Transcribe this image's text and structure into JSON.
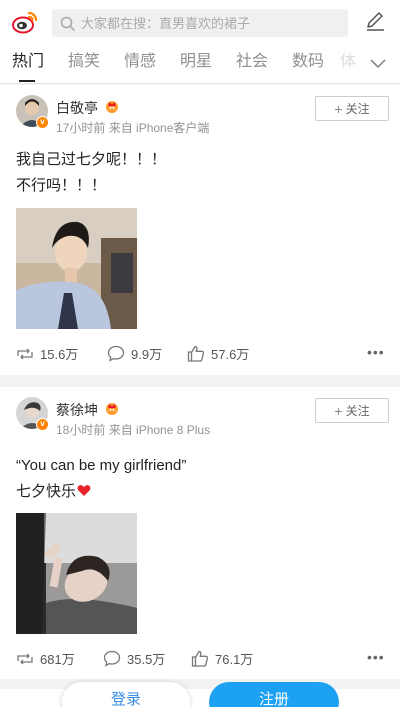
{
  "search": {
    "placeholder": "大家都在搜：直男喜欢的裙子"
  },
  "tabs": [
    "热门",
    "搞笑",
    "情感",
    "明星",
    "社会",
    "数码",
    "体"
  ],
  "colors": {
    "accent": "#ff8200",
    "brand": "#e6162d",
    "register": "#1da1f2",
    "login_text": "#3a8ee6"
  },
  "posts": [
    {
      "name": "白敬亭",
      "time": "17小时前",
      "source": "来自 iPhone客户端",
      "follow_label": "关注",
      "text_lines": [
        "我自己过七夕呢！！！",
        "不行吗！！！"
      ],
      "repost": "15.6万",
      "comment": "9.9万",
      "like": "57.6万"
    },
    {
      "name": "蔡徐坤",
      "time": "18小时前",
      "source": "来自 iPhone 8 Plus",
      "follow_label": "关注",
      "text_lines": [
        "“You can be my girlfriend”",
        "七夕快乐"
      ],
      "repost": "681万",
      "comment": "35.5万",
      "like": "76.1万"
    }
  ],
  "bottom": {
    "login": "登录",
    "register": "注册"
  },
  "icons": {
    "logo": "weibo-logo-icon",
    "search": "search-icon",
    "compose": "compose-icon",
    "more_tabs": "chevron-down-icon",
    "repost": "repost-icon",
    "comment": "comment-icon",
    "like": "thumbs-up-icon",
    "more": "more-icon",
    "heart": "heart-icon"
  }
}
